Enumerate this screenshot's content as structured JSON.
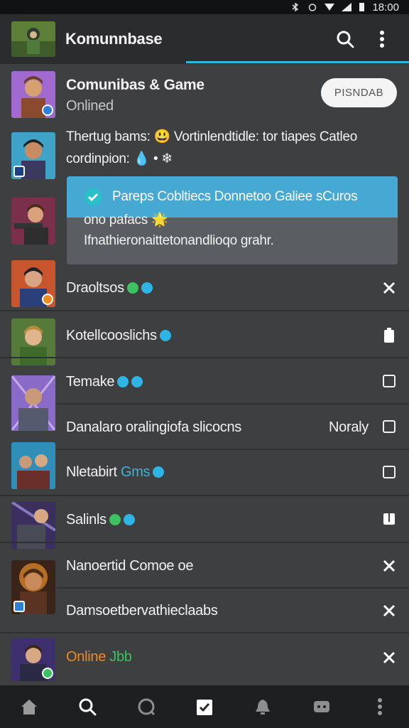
{
  "status_bar": {
    "time": "18:00"
  },
  "app_bar": {
    "title": "Komunnbase"
  },
  "header_item": {
    "title": "Comunibas & Game",
    "subtitle": "Onlined",
    "pending_label": "PISNDAB"
  },
  "message": {
    "line1": "Thertug bams: 😃 Vortinlendtidle: tor tiapes Catleo",
    "line2": "cordinpion: 💧 • ❄"
  },
  "card": {
    "line1": "Pareps Cobltiecs Donnetoo Galiee sCuros",
    "line2": "ono pafacs 🌟",
    "line3": "Ifnathieronaittetonandlioqo grahr."
  },
  "rows": [
    {
      "name": "Draoltsos"
    },
    {
      "name": "Kotellcooslichs"
    },
    {
      "name": "Temake"
    },
    {
      "name": "Danalaro oralingiofa slicocns",
      "tag": "Noraly"
    },
    {
      "name": "Nletabirt",
      "extra": "Gms"
    },
    {
      "name": "Salinls"
    },
    {
      "name": "Nanoertid Comoe oe"
    },
    {
      "name": "Damsoetbervathieclaabs"
    },
    {
      "name": "Online",
      "extra": "Jbb"
    }
  ],
  "colors": {
    "accent": "#36b7d8",
    "verified": "#2fb4e6",
    "online_orange": "#f08a1c",
    "online_green": "#3cc260"
  }
}
